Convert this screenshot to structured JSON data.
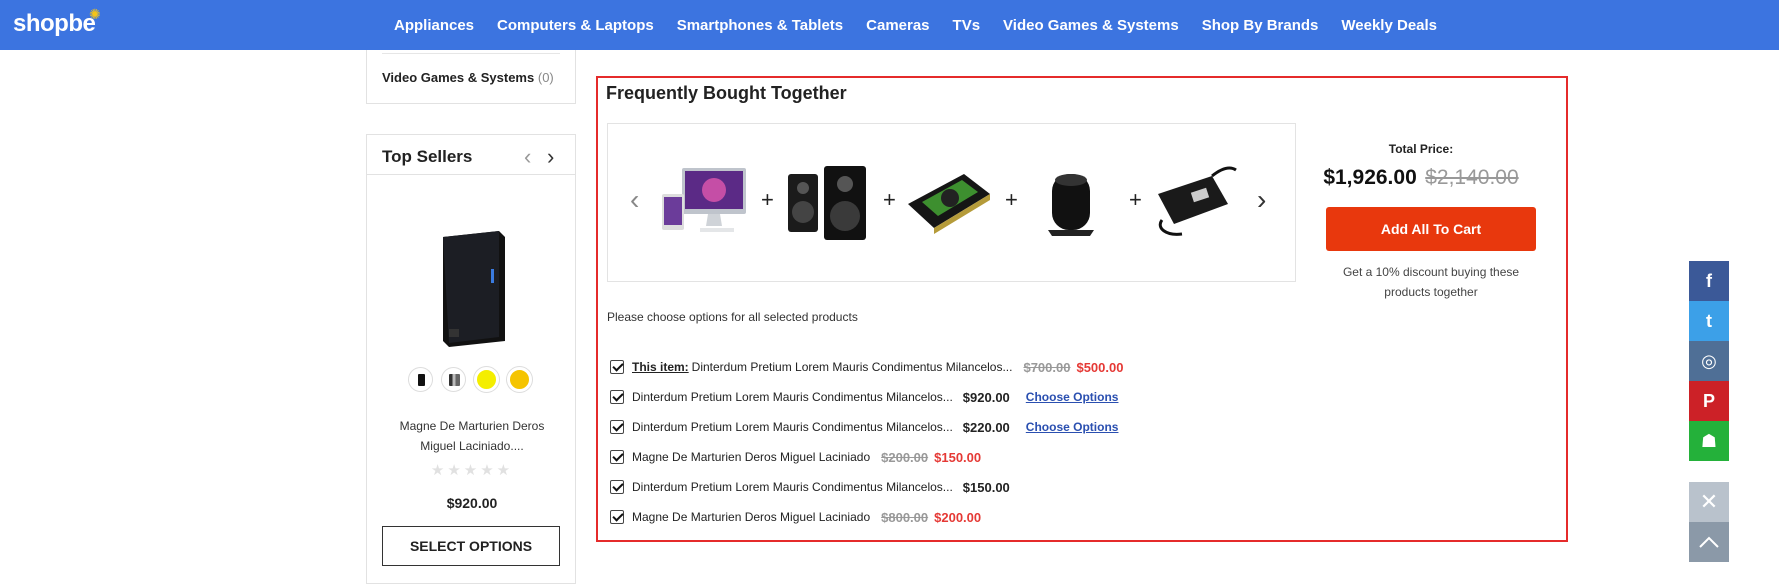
{
  "header": {
    "logo": "shopbe",
    "nav": [
      "Appliances",
      "Computers & Laptops",
      "Smartphones & Tablets",
      "Cameras",
      "TVs",
      "Video Games & Systems",
      "Shop By Brands",
      "Weekly Deals"
    ]
  },
  "sidebar": {
    "category": {
      "label": "Video Games & Systems",
      "count": "(0)"
    },
    "top_sellers": {
      "title": "Top Sellers",
      "product_name": "Magne De Marturien Deros Miguel Laciniado....",
      "stars": "★★★★★",
      "price": "$920.00",
      "button": "SELECT OPTIONS"
    }
  },
  "fbt": {
    "title": "Frequently Bought Together",
    "images": [
      "imac-icon",
      "speakers-icon",
      "graphics-card-icon",
      "mac-pro-icon",
      "power-adapter-icon"
    ],
    "total_label": "Total Price:",
    "total_now": "$1,926.00",
    "total_old": "$2,140.00",
    "add_button": "Add All To Cart",
    "discount_note": "Get a 10% discount buying these products together",
    "choose_note": "Please choose options for all selected products",
    "items": [
      {
        "prefix": "This item:",
        "name": "Dinterdum Pretium Lorem Mauris Condimentus Milancelos...",
        "old": "$700.00",
        "sale": "$500.00"
      },
      {
        "name": "Dinterdum Pretium Lorem Mauris Condimentus Milancelos...",
        "price": "$920.00",
        "link": "Choose Options"
      },
      {
        "name": "Dinterdum Pretium Lorem Mauris Condimentus Milancelos...",
        "price": "$220.00",
        "link": "Choose Options"
      },
      {
        "name": "Magne De Marturien Deros Miguel Laciniado",
        "old": "$200.00",
        "sale": "$150.00"
      },
      {
        "name": "Dinterdum Pretium Lorem Mauris Condimentus Milancelos...",
        "price": "$150.00"
      },
      {
        "name": "Magne De Marturien Deros Miguel Laciniado",
        "old": "$800.00",
        "sale": "$200.00"
      }
    ]
  },
  "social": [
    {
      "icon": "facebook-icon",
      "glyph": "f",
      "color": "#3b5998"
    },
    {
      "icon": "twitter-icon",
      "glyph": "t",
      "color": "#3ca0e8"
    },
    {
      "icon": "instagram-icon",
      "glyph": "◎",
      "color": "#4f6f96"
    },
    {
      "icon": "pinterest-icon",
      "glyph": "P",
      "color": "#cc2127"
    },
    {
      "icon": "snapchat-icon",
      "glyph": "☗",
      "color": "#24b13a"
    }
  ],
  "close_glyph": "✕"
}
